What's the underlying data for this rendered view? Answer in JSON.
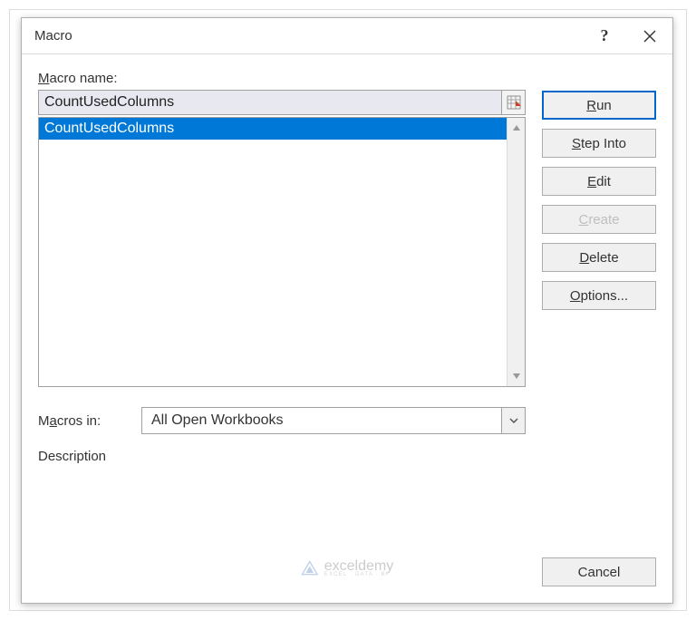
{
  "titlebar": {
    "title": "Macro"
  },
  "labels": {
    "macro_name": "acro name:",
    "macro_name_prefix": "M",
    "macros_in_prefix": "M",
    "macros_in": "cros in:",
    "macros_in_accel": "a",
    "description": "Description"
  },
  "input": {
    "macro_name_value": "CountUsedColumns"
  },
  "list": {
    "items": [
      "CountUsedColumns"
    ],
    "selected_index": 0
  },
  "macros_in": {
    "selected": "All Open Workbooks"
  },
  "buttons": {
    "run": "un",
    "run_prefix": "R",
    "step_into_prefix": "S",
    "step_into": "tep Into",
    "edit": "dit",
    "edit_prefix": "E",
    "create_prefix": "C",
    "create": "reate",
    "delete_prefix": "D",
    "delete": "elete",
    "options_prefix": "O",
    "options": "ptions...",
    "cancel": "Cancel"
  },
  "watermark": {
    "brand": "exceldemy",
    "tag": "EXCEL · DATA · BI"
  }
}
